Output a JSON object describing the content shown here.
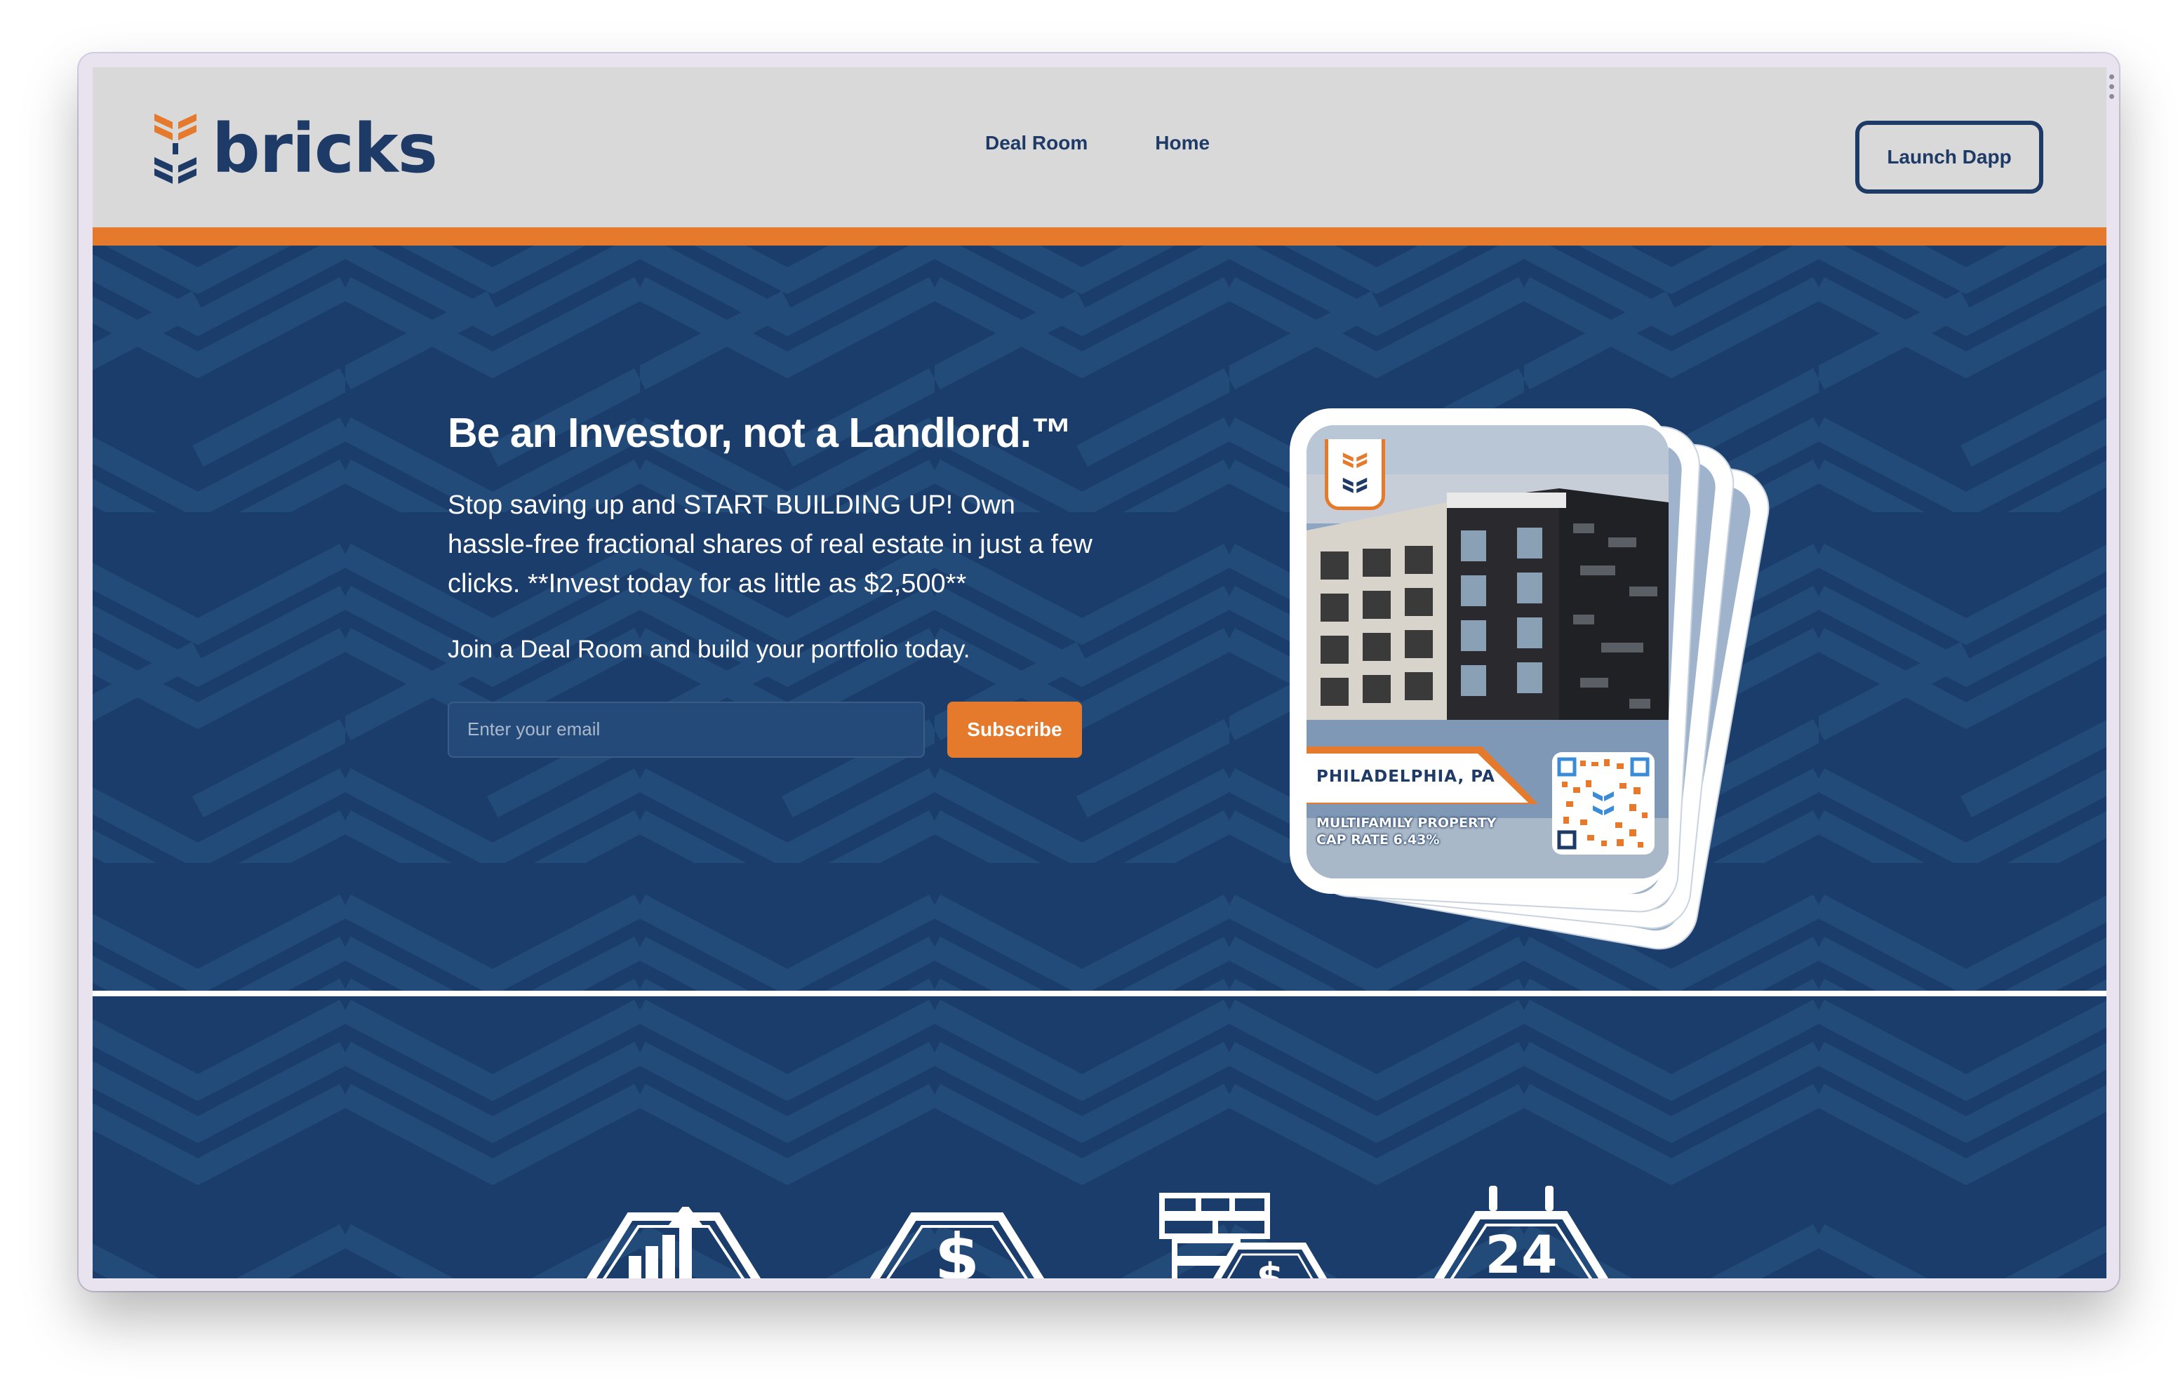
{
  "brand": {
    "name": "bricks"
  },
  "nav": {
    "items": [
      {
        "label": "Deal Room"
      },
      {
        "label": "Home"
      }
    ],
    "cta_label": "Launch Dapp"
  },
  "hero": {
    "title": "Be an Investor, not a Landlord.™",
    "subtitle": "Stop saving up and START BUILDING UP! Own hassle-free fractional shares of real estate in just a few clicks. **Invest today for as little as $2,500**",
    "join_text": "Join a Deal Room and build your portfolio today.",
    "email_placeholder": "Enter your email",
    "subscribe_label": "Subscribe"
  },
  "property_card": {
    "city": "PHILADELPHIA, PA",
    "type_line1": "MULTIFAMILY PROPERTY",
    "type_line2": "CAP RATE 6.43%"
  },
  "features": {
    "icons": [
      "growth-chart-icon",
      "dollar-hexagon-icon",
      "bricks-dollar-icon",
      "calendar-24-icon"
    ],
    "calendar_number": "24"
  },
  "colors": {
    "navy": "#1a3d6b",
    "orange": "#e57a2c",
    "header_bg": "#d9d9d9",
    "brand_text": "#1e3a66"
  }
}
